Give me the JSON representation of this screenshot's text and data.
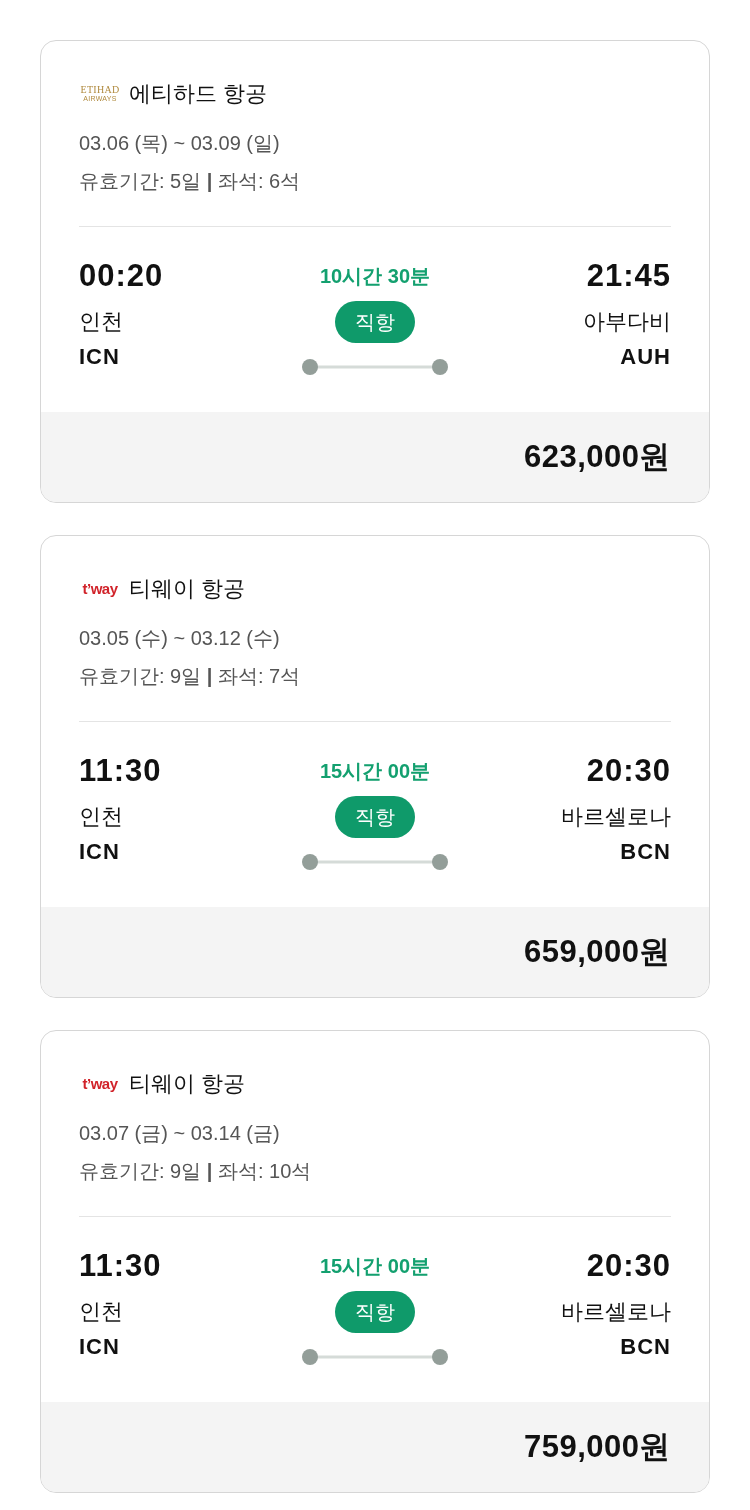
{
  "flights": [
    {
      "airline": {
        "logo": {
          "kind": "etihad",
          "wordmark": "ETIHAD",
          "tagline": "AIRWAYS"
        },
        "name": "에티하드 항공"
      },
      "dates": "03.06 (목) ~ 03.09 (일)",
      "details": "유효기간: 5일 **|** 좌석: 6석",
      "departure": {
        "time": "00:20",
        "city": "인천",
        "code": "ICN"
      },
      "duration": "10시간 30분",
      "route_type": "직항",
      "arrival": {
        "time": "21:45",
        "city": "아부다비",
        "code": "AUH"
      },
      "price": "623,000원"
    },
    {
      "airline": {
        "logo": {
          "kind": "tway",
          "wordmark": "t’way"
        },
        "name": "티웨이 항공"
      },
      "dates": "03.05 (수) ~ 03.12 (수)",
      "details": "유효기간: 9일 **|** 좌석: 7석",
      "departure": {
        "time": "11:30",
        "city": "인천",
        "code": "ICN"
      },
      "duration": "15시간 00분",
      "route_type": "직항",
      "arrival": {
        "time": "20:30",
        "city": "바르셀로나",
        "code": "BCN"
      },
      "price": "659,000원"
    },
    {
      "airline": {
        "logo": {
          "kind": "tway",
          "wordmark": "t’way"
        },
        "name": "티웨이 항공"
      },
      "dates": "03.07 (금) ~ 03.14 (금)",
      "details": "유효기간: 9일 **|** 좌석: 10석",
      "departure": {
        "time": "11:30",
        "city": "인천",
        "code": "ICN"
      },
      "duration": "15시간 00분",
      "route_type": "직항",
      "arrival": {
        "time": "20:30",
        "city": "바르셀로나",
        "code": "BCN"
      },
      "price": "759,000원"
    }
  ]
}
